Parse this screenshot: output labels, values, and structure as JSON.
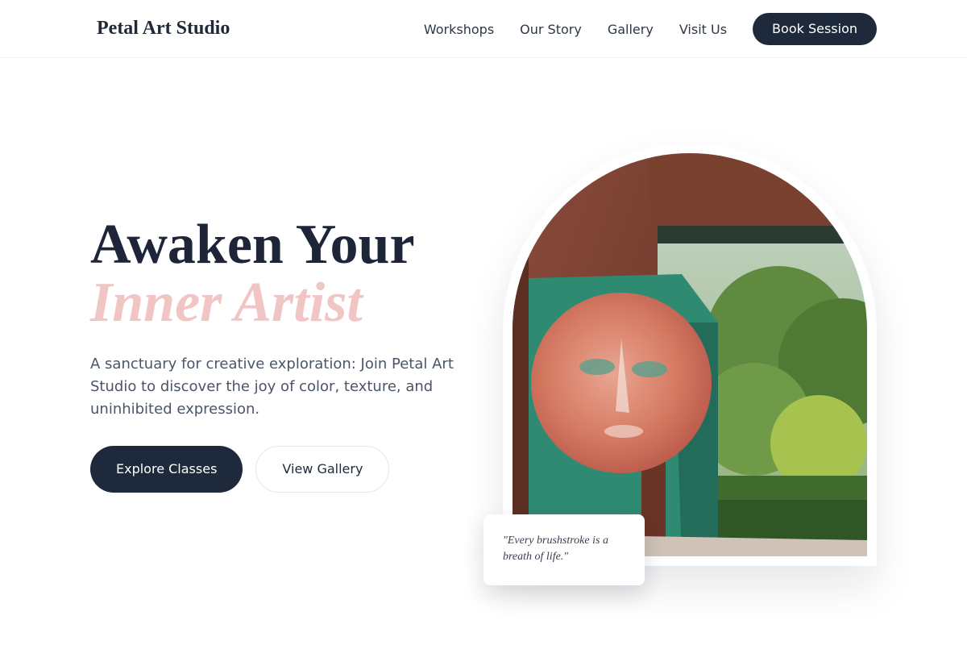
{
  "brand": {
    "name": "Petal Art Studio"
  },
  "nav": {
    "items": [
      {
        "label": "Workshops"
      },
      {
        "label": "Our Story"
      },
      {
        "label": "Gallery"
      },
      {
        "label": "Visit Us"
      }
    ],
    "cta_label": "Book Session"
  },
  "hero": {
    "headline_line1": "Awaken Your",
    "headline_line2": "Inner Artist",
    "description": "A sanctuary for creative exploration: Join Petal Art Studio to discover the joy of color, texture, and uninhibited expression.",
    "primary_cta": "Explore Classes",
    "secondary_cta": "View Gallery",
    "quote": "\"Every brushstroke is a breath of life.\""
  },
  "colors": {
    "primary": "#1e293b",
    "accent": "#f1c5c3",
    "text_muted": "#4a5568"
  }
}
